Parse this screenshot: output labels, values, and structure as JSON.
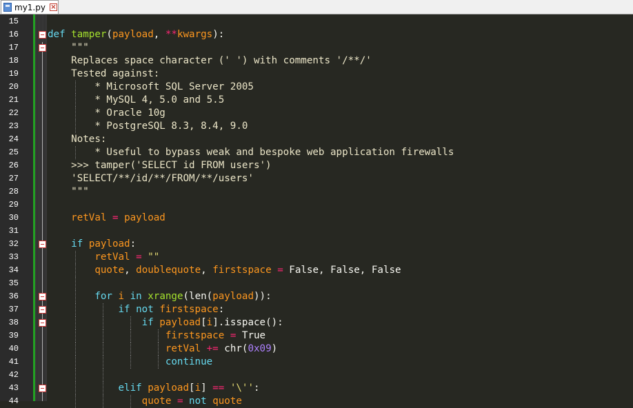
{
  "tab": {
    "title": "my1.py"
  },
  "colors": {
    "background": "#272822",
    "keyword": "#66d9ef",
    "function": "#a6e22e",
    "variable": "#fd971f",
    "operator": "#f92672",
    "string": "#e6db74",
    "number": "#ae81ff",
    "change_bar": "#23a123"
  },
  "editor": {
    "lines": [
      {
        "num": "15",
        "fold": false,
        "indent": 0,
        "tokens": []
      },
      {
        "num": "16",
        "fold": true,
        "indent": 0,
        "tokens": [
          [
            "def",
            "kw"
          ],
          [
            " ",
            "plain"
          ],
          [
            "tamper",
            "fn"
          ],
          [
            "(",
            "plain"
          ],
          [
            "payload",
            "var"
          ],
          [
            ", ",
            "plain"
          ],
          [
            "**",
            "op"
          ],
          [
            "kwargs",
            "var"
          ],
          [
            "):",
            "plain"
          ]
        ]
      },
      {
        "num": "17",
        "fold": true,
        "indent": 1,
        "tokens": [
          [
            "    \"\"\"",
            "doc"
          ]
        ]
      },
      {
        "num": "18",
        "fold": false,
        "indent": 1,
        "tokens": [
          [
            "    Replaces space character (' ') with comments '/**/'",
            "doc"
          ]
        ]
      },
      {
        "num": "19",
        "fold": false,
        "indent": 1,
        "tokens": [
          [
            "    Tested against:",
            "doc"
          ]
        ]
      },
      {
        "num": "20",
        "fold": false,
        "indent": 2,
        "tokens": [
          [
            "        * Microsoft SQL Server 2005",
            "doc"
          ]
        ]
      },
      {
        "num": "21",
        "fold": false,
        "indent": 2,
        "tokens": [
          [
            "        * MySQL 4, 5.0 and 5.5",
            "doc"
          ]
        ]
      },
      {
        "num": "22",
        "fold": false,
        "indent": 2,
        "tokens": [
          [
            "        * Oracle 10g",
            "doc"
          ]
        ]
      },
      {
        "num": "23",
        "fold": false,
        "indent": 2,
        "tokens": [
          [
            "        * PostgreSQL 8.3, 8.4, 9.0",
            "doc"
          ]
        ]
      },
      {
        "num": "24",
        "fold": false,
        "indent": 1,
        "tokens": [
          [
            "    Notes:",
            "doc"
          ]
        ]
      },
      {
        "num": "25",
        "fold": false,
        "indent": 2,
        "tokens": [
          [
            "        * Useful to bypass weak and bespoke web application firewalls",
            "doc"
          ]
        ]
      },
      {
        "num": "26",
        "fold": false,
        "indent": 1,
        "tokens": [
          [
            "    >>> tamper('SELECT id FROM users')",
            "doc"
          ]
        ]
      },
      {
        "num": "27",
        "fold": false,
        "indent": 1,
        "tokens": [
          [
            "    'SELECT/**/id/**/FROM/**/users'",
            "doc"
          ]
        ]
      },
      {
        "num": "28",
        "fold": false,
        "indent": 1,
        "tokens": [
          [
            "    \"\"\"",
            "doc"
          ]
        ]
      },
      {
        "num": "29",
        "fold": false,
        "indent": 1,
        "tokens": []
      },
      {
        "num": "30",
        "fold": false,
        "indent": 1,
        "tokens": [
          [
            "    ",
            "plain"
          ],
          [
            "retVal",
            "var"
          ],
          [
            " ",
            "plain"
          ],
          [
            "=",
            "op"
          ],
          [
            " ",
            "plain"
          ],
          [
            "payload",
            "var"
          ]
        ]
      },
      {
        "num": "31",
        "fold": false,
        "indent": 1,
        "tokens": []
      },
      {
        "num": "32",
        "fold": true,
        "indent": 1,
        "tokens": [
          [
            "    ",
            "plain"
          ],
          [
            "if",
            "kw"
          ],
          [
            " ",
            "plain"
          ],
          [
            "payload",
            "var"
          ],
          [
            ":",
            "plain"
          ]
        ]
      },
      {
        "num": "33",
        "fold": false,
        "indent": 2,
        "tokens": [
          [
            "        ",
            "plain"
          ],
          [
            "retVal",
            "var"
          ],
          [
            " ",
            "plain"
          ],
          [
            "=",
            "op"
          ],
          [
            " ",
            "plain"
          ],
          [
            "\"\"",
            "str"
          ]
        ]
      },
      {
        "num": "34",
        "fold": false,
        "indent": 2,
        "tokens": [
          [
            "        ",
            "plain"
          ],
          [
            "quote",
            "var"
          ],
          [
            ", ",
            "plain"
          ],
          [
            "doublequote",
            "var"
          ],
          [
            ", ",
            "plain"
          ],
          [
            "firstspace",
            "var"
          ],
          [
            " ",
            "plain"
          ],
          [
            "=",
            "op"
          ],
          [
            " False, False, False",
            "plain"
          ]
        ]
      },
      {
        "num": "35",
        "fold": false,
        "indent": 2,
        "tokens": []
      },
      {
        "num": "36",
        "fold": true,
        "indent": 2,
        "tokens": [
          [
            "        ",
            "plain"
          ],
          [
            "for",
            "kw"
          ],
          [
            " ",
            "plain"
          ],
          [
            "i",
            "var"
          ],
          [
            " ",
            "plain"
          ],
          [
            "in",
            "kw"
          ],
          [
            " ",
            "plain"
          ],
          [
            "xrange",
            "fn"
          ],
          [
            "(",
            "plain"
          ],
          [
            "len",
            "plain"
          ],
          [
            "(",
            "plain"
          ],
          [
            "payload",
            "var"
          ],
          [
            ")):",
            "plain"
          ]
        ]
      },
      {
        "num": "37",
        "fold": true,
        "indent": 3,
        "tokens": [
          [
            "            ",
            "plain"
          ],
          [
            "if",
            "kw"
          ],
          [
            " ",
            "plain"
          ],
          [
            "not",
            "kw"
          ],
          [
            " ",
            "plain"
          ],
          [
            "firstspace",
            "var"
          ],
          [
            ":",
            "plain"
          ]
        ]
      },
      {
        "num": "38",
        "fold": true,
        "indent": 4,
        "tokens": [
          [
            "                ",
            "plain"
          ],
          [
            "if",
            "kw"
          ],
          [
            " ",
            "plain"
          ],
          [
            "payload",
            "var"
          ],
          [
            "[",
            "plain"
          ],
          [
            "i",
            "var"
          ],
          [
            "].isspace():",
            "plain"
          ]
        ]
      },
      {
        "num": "39",
        "fold": false,
        "indent": 5,
        "tokens": [
          [
            "                    ",
            "plain"
          ],
          [
            "firstspace",
            "var"
          ],
          [
            " ",
            "plain"
          ],
          [
            "=",
            "op"
          ],
          [
            " True",
            "plain"
          ]
        ]
      },
      {
        "num": "40",
        "fold": false,
        "indent": 5,
        "tokens": [
          [
            "                    ",
            "plain"
          ],
          [
            "retVal",
            "var"
          ],
          [
            " ",
            "plain"
          ],
          [
            "+=",
            "op"
          ],
          [
            " chr(",
            "plain"
          ],
          [
            "0x09",
            "num"
          ],
          [
            ")",
            "plain"
          ]
        ]
      },
      {
        "num": "41",
        "fold": false,
        "indent": 5,
        "tokens": [
          [
            "                    ",
            "plain"
          ],
          [
            "continue",
            "kw"
          ]
        ]
      },
      {
        "num": "42",
        "fold": false,
        "indent": 3,
        "tokens": []
      },
      {
        "num": "43",
        "fold": true,
        "indent": 3,
        "tokens": [
          [
            "            ",
            "plain"
          ],
          [
            "elif",
            "kw"
          ],
          [
            " ",
            "plain"
          ],
          [
            "payload",
            "var"
          ],
          [
            "[",
            "plain"
          ],
          [
            "i",
            "var"
          ],
          [
            "] ",
            "plain"
          ],
          [
            "==",
            "op"
          ],
          [
            " ",
            "plain"
          ],
          [
            "'\\''",
            "str"
          ],
          [
            ":",
            "plain"
          ]
        ]
      },
      {
        "num": "44",
        "fold": false,
        "indent": 4,
        "tokens": [
          [
            "                ",
            "plain"
          ],
          [
            "quote",
            "var"
          ],
          [
            " ",
            "plain"
          ],
          [
            "=",
            "op"
          ],
          [
            " ",
            "plain"
          ],
          [
            "not",
            "kw"
          ],
          [
            " ",
            "plain"
          ],
          [
            "quote",
            "var"
          ]
        ]
      }
    ]
  }
}
